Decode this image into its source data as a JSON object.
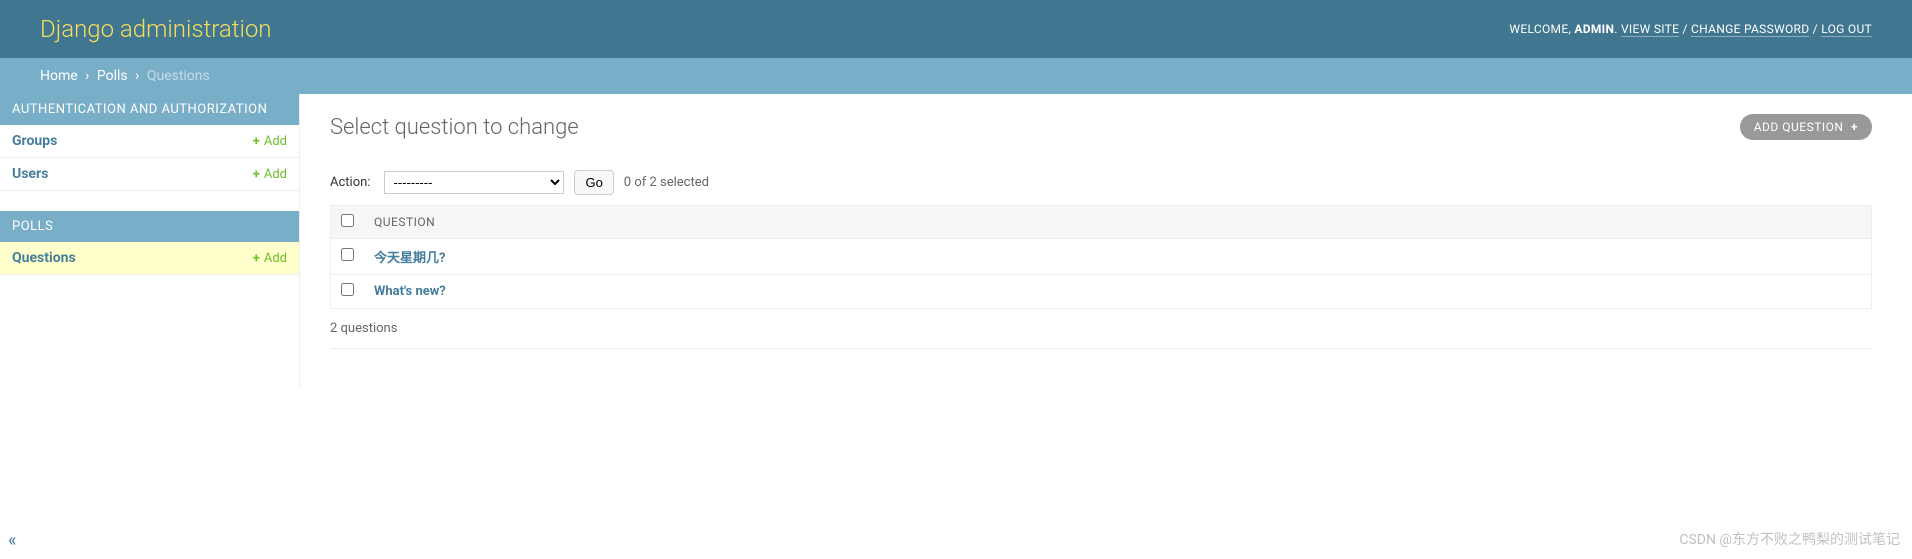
{
  "header": {
    "branding": "Django administration",
    "welcome": "WELCOME, ",
    "username": "ADMIN",
    "view_site": "VIEW SITE",
    "change_password": "CHANGE PASSWORD",
    "logout": "LOG OUT"
  },
  "breadcrumbs": {
    "home": "Home",
    "app": "Polls",
    "model": "Questions",
    "sep": "›"
  },
  "sidebar": {
    "auth": {
      "caption": "AUTHENTICATION AND AUTHORIZATION",
      "rows": [
        {
          "name": "Groups",
          "add": "Add"
        },
        {
          "name": "Users",
          "add": "Add"
        }
      ]
    },
    "polls": {
      "caption": "POLLS",
      "rows": [
        {
          "name": "Questions",
          "add": "Add",
          "current": true
        }
      ]
    }
  },
  "content": {
    "title": "Select question to change",
    "add_button": "ADD QUESTION"
  },
  "actions": {
    "label": "Action:",
    "placeholder": "---------",
    "go": "Go",
    "counter": "0 of 2 selected"
  },
  "results": {
    "header": "QUESTION",
    "rows": [
      {
        "text": "今天星期几?"
      },
      {
        "text": "What's new?"
      }
    ],
    "paginator": "2 questions"
  },
  "watermark": "CSDN @东方不败之鸭梨的测试笔记"
}
